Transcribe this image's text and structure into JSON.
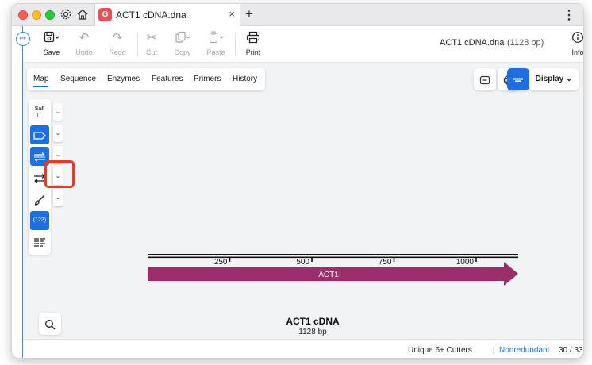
{
  "tabbar": {
    "tab_title": "ACT1 cDNA.dna",
    "add_tab": "+",
    "close_tab": "×",
    "menu": "⋮"
  },
  "toolbar": {
    "save": "Save",
    "undo": "Undo",
    "redo": "Redo",
    "cut": "Cut",
    "copy": "Copy",
    "paste": "Paste",
    "print": "Print",
    "info": "Info",
    "document_title": "ACT1 cDNA.dna",
    "document_length": "(1128 bp)"
  },
  "view_tabs": [
    "Map",
    "Sequence",
    "Enzymes",
    "Features",
    "Primers",
    "History"
  ],
  "active_view_tab": "Map",
  "right_controls": {
    "display": "Display"
  },
  "left_tools": {
    "enzyme_label": "SalI",
    "numbering_label": "(123)"
  },
  "map": {
    "sequence_name": "ACT1 cDNA",
    "sequence_length": "1128 bp",
    "feature_name": "ACT1",
    "ticks": [
      "250",
      "500",
      "750",
      "1000"
    ],
    "feature_color": "#9b2d6b"
  },
  "status": {
    "cutters": "Unique 6+ Cutters",
    "separator": "|",
    "mode": "Nonredundant",
    "count": "30 / 33"
  },
  "colors": {
    "accent": "#1d6fe0",
    "highlight": "#e03e2a"
  }
}
